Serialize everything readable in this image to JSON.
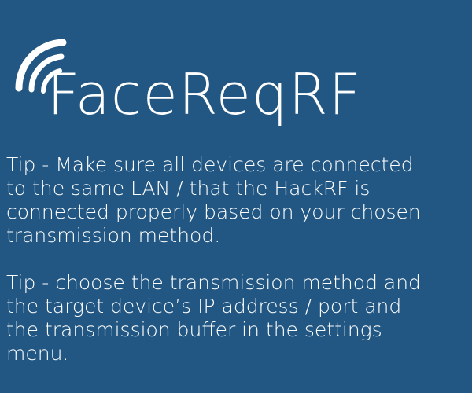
{
  "app": {
    "title": "FaceReqRF",
    "logo_icon": "wireless-signal-icon",
    "background_color": "#225783",
    "text_color": "#ffffff"
  },
  "tips": [
    {
      "lines": [
        "Tip - Make sure all devices are connected",
        "to the same LAN / that the HackRF is",
        "connected properly based on your chosen",
        "transmission method."
      ]
    },
    {
      "lines": [
        "Tip - choose the transmission method and",
        "the target device’s IP address / port and",
        "the transmission buffer in the settings",
        "menu."
      ]
    }
  ]
}
